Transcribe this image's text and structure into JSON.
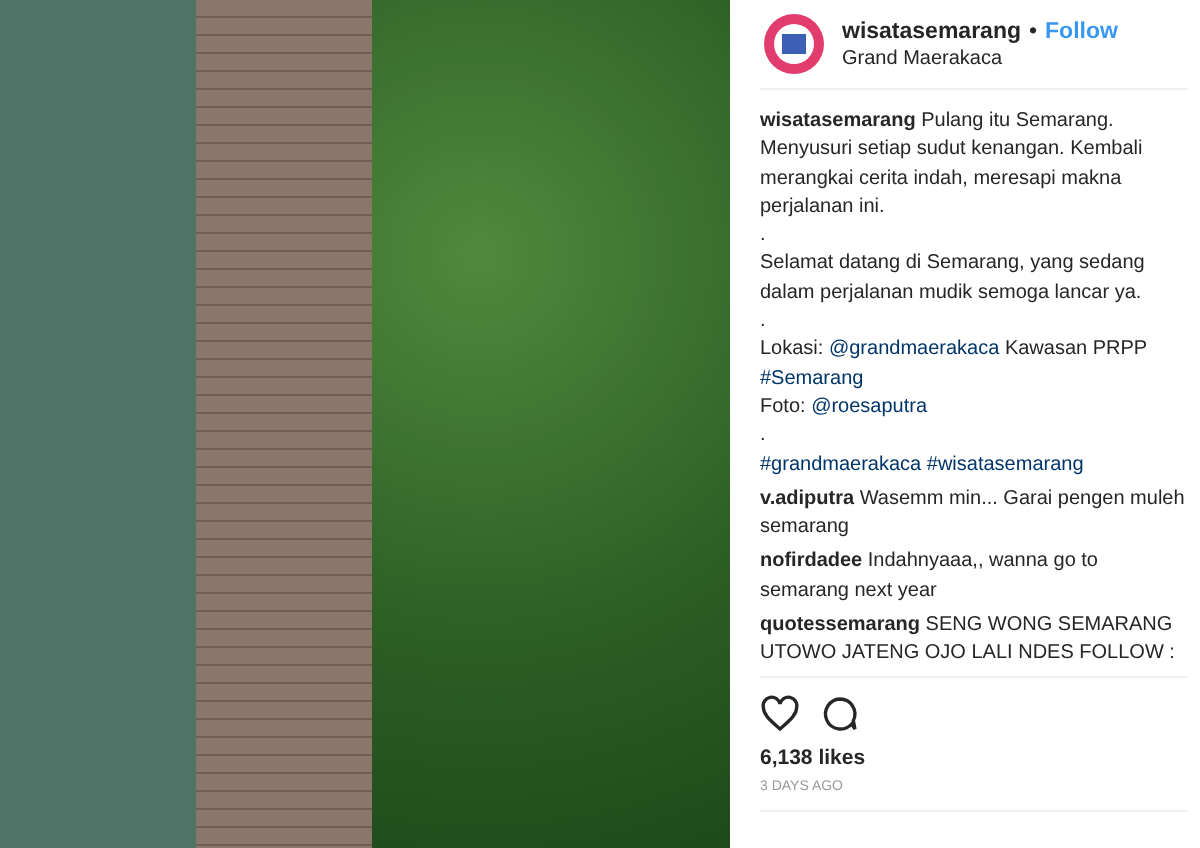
{
  "header": {
    "username": "wisatasemarang",
    "separator": "•",
    "follow": "Follow",
    "location": "Grand Maerakaca"
  },
  "caption": [
    {
      "parts": [
        {
          "kind": "user",
          "text": "wisatasemarang"
        },
        {
          "kind": "text",
          "text": " Pulang itu Semarang. Menyusuri setiap sudut kenangan. Kembali merangkai cerita indah, meresapi makna perjalanan ini."
        }
      ]
    },
    {
      "parts": [
        {
          "kind": "text",
          "text": "."
        }
      ]
    },
    {
      "parts": [
        {
          "kind": "text",
          "text": "Selamat datang di Semarang, yang sedang dalam perjalanan mudik semoga lancar ya."
        }
      ]
    },
    {
      "parts": [
        {
          "kind": "text",
          "text": "."
        }
      ]
    },
    {
      "parts": [
        {
          "kind": "text",
          "text": "Lokasi: "
        },
        {
          "kind": "link",
          "text": "@grandmaerakaca"
        },
        {
          "kind": "text",
          "text": " Kawasan PRPP"
        }
      ]
    },
    {
      "parts": [
        {
          "kind": "link",
          "text": "#Semarang"
        }
      ]
    },
    {
      "parts": [
        {
          "kind": "text",
          "text": "Foto: "
        },
        {
          "kind": "link",
          "text": "@roesaputra"
        }
      ]
    },
    {
      "parts": [
        {
          "kind": "text",
          "text": "."
        }
      ]
    },
    {
      "parts": [
        {
          "kind": "link",
          "text": "#grandmaerakaca"
        },
        {
          "kind": "link",
          "text": "#wisatasemarang"
        }
      ]
    }
  ],
  "comments": [
    {
      "user": "v.adiputra",
      "text": "Wasemm min... Garai pengen muleh semarang"
    },
    {
      "user": "nofirdadee",
      "text": "Indahnyaaa,, wanna go to semarang next year"
    },
    {
      "user": "quotessemarang",
      "text": "SENG WONG SEMARANG UTOWO JATENG OJO LALI NDES FOLLOW :"
    }
  ],
  "likes": "6,138 likes",
  "time": "3 DAYS AGO"
}
